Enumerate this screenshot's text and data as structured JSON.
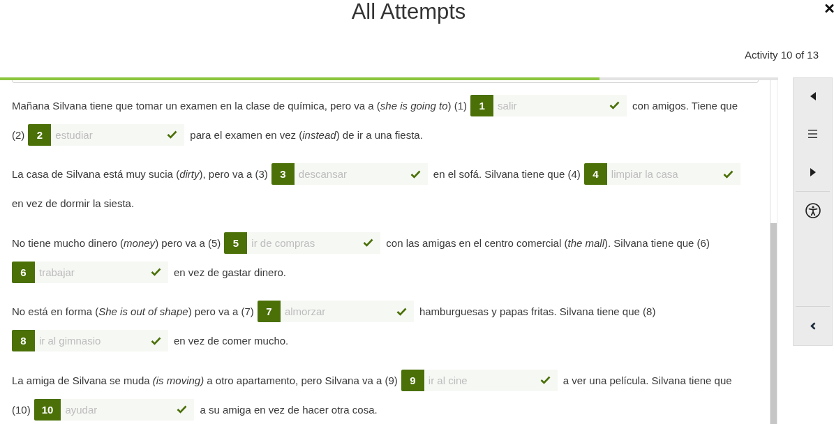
{
  "header": {
    "title": "All Attempts",
    "activity_counter": "Activity 10 of 13"
  },
  "progress": {
    "level": 0.77
  },
  "paragraphs": [
    {
      "lines": [
        {
          "parts": [
            {
              "kind": "text",
              "text": "Mañana Silvana tiene que tomar un examen en la clase de química, pero va a (*she is going to*) (1)"
            },
            {
              "kind": "blank",
              "number": "1",
              "value": "salir",
              "correct": true
            },
            {
              "kind": "text",
              "text": "con amigos. Tiene que"
            }
          ]
        },
        {
          "parts": [
            {
              "kind": "text",
              "text": "(2)"
            },
            {
              "kind": "blank",
              "number": "2",
              "value": "estudiar",
              "correct": true
            },
            {
              "kind": "text",
              "text": "para el examen en vez (*instead*) de ir a una fiesta."
            }
          ]
        }
      ]
    },
    {
      "lines": [
        {
          "parts": [
            {
              "kind": "text",
              "text": "La casa de Silvana está muy sucia (*dirty*), pero va a (3)"
            },
            {
              "kind": "blank",
              "number": "3",
              "value": "descansar",
              "correct": true
            },
            {
              "kind": "text",
              "text": "en el sofá. Silvana tiene que (4)"
            },
            {
              "kind": "blank",
              "number": "4",
              "value": "limpiar la casa",
              "correct": true
            }
          ]
        },
        {
          "parts": [
            {
              "kind": "text",
              "text": "en vez de dormir la siesta."
            }
          ]
        }
      ]
    },
    {
      "lines": [
        {
          "parts": [
            {
              "kind": "text",
              "text": "No tiene mucho dinero (*money*) pero va a (5)"
            },
            {
              "kind": "blank",
              "number": "5",
              "value": "ir de compras",
              "correct": true
            },
            {
              "kind": "text",
              "text": "con las amigas en el centro comercial (*the mall*). Silvana tiene que (6)"
            }
          ]
        },
        {
          "parts": [
            {
              "kind": "blank",
              "number": "6",
              "value": "trabajar",
              "correct": true
            },
            {
              "kind": "text",
              "text": "en vez de gastar dinero."
            }
          ]
        }
      ]
    },
    {
      "lines": [
        {
          "parts": [
            {
              "kind": "text",
              "text": "No está en forma (*She is out of shape*) pero va a (7)"
            },
            {
              "kind": "blank",
              "number": "7",
              "value": "almorzar",
              "correct": true
            },
            {
              "kind": "text",
              "text": "hamburguesas y papas fritas. Silvana tiene que (8)"
            }
          ]
        },
        {
          "parts": [
            {
              "kind": "blank",
              "number": "8",
              "value": "ir al gimnasio",
              "correct": true
            },
            {
              "kind": "text",
              "text": "en vez de comer mucho."
            }
          ]
        }
      ]
    },
    {
      "lines": [
        {
          "parts": [
            {
              "kind": "text",
              "text": "La amiga de Silvana se muda *(is moving)* a otro apartamento, pero Silvana va a (9)"
            },
            {
              "kind": "blank",
              "number": "9",
              "value": "ir al cine",
              "correct": true
            },
            {
              "kind": "text",
              "text": "a ver una película. Silvana tiene que"
            }
          ]
        },
        {
          "parts": [
            {
              "kind": "text",
              "text": "(10)"
            },
            {
              "kind": "blank",
              "number": "10",
              "value": "ayudar",
              "correct": true
            },
            {
              "kind": "text",
              "text": "a su amiga en vez de hacer otra cosa."
            }
          ]
        }
      ]
    }
  ]
}
